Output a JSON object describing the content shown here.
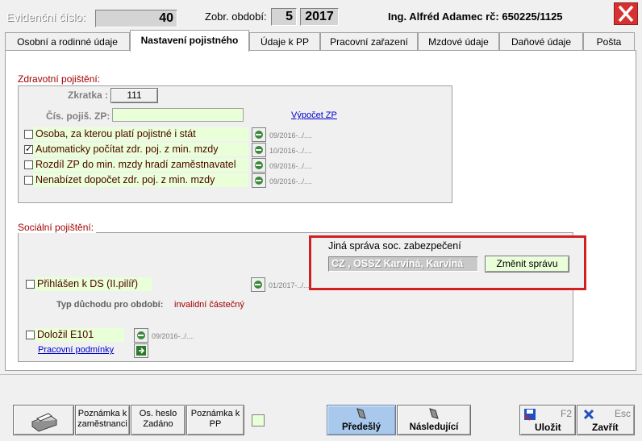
{
  "header": {
    "ev_cislo_label": "Evidenční číslo:",
    "ev_cislo_value": "40",
    "obdobi_label": "Zobr. období:",
    "obdobi_month": "5",
    "obdobi_year": "2017",
    "employee": "Ing. Alfréd Adamec rč: 650225/1125"
  },
  "tabs": [
    {
      "label": "Osobní a rodinné údaje"
    },
    {
      "label": "Nastavení pojistného"
    },
    {
      "label": "Údaje k PP"
    },
    {
      "label": "Pracovní zařazení"
    },
    {
      "label": "Mzdové údaje"
    },
    {
      "label": "Daňové údaje"
    },
    {
      "label": "Pošta"
    }
  ],
  "zdrav": {
    "legend": "Zdravotní pojištění:",
    "zkratka_label": "Zkratka :",
    "zkratka_value": "111",
    "cis_label": "Čís. pojiš. ZP:",
    "cis_value": "",
    "vypocet_link": "Výpočet ZP",
    "items": [
      {
        "label": "Osoba, za kterou platí pojistné i stát",
        "checked": false,
        "date": "09/2016-../...."
      },
      {
        "label": "Automaticky počítat zdr. poj. z min. mzdy",
        "checked": true,
        "date": "10/2016-../...."
      },
      {
        "label": "Rozdíl ZP do min. mzdy hradí zaměstnavatel",
        "checked": false,
        "date": "09/2016-../...."
      },
      {
        "label": "Nenabízet dopočet zdr. poj. z min. mzdy",
        "checked": false,
        "date": "09/2016-../...."
      }
    ]
  },
  "soc": {
    "legend": "Sociální pojištění:",
    "jina_label": "Jiná správa soc. zabezpečení",
    "jina_value": "CZ , OSSZ Karviná, Karviná",
    "zmenit_button": "Změnit správu",
    "ds_label": "Přihlášen k DS (II.pilíř)",
    "ds_date": "01/2017-../....",
    "typ_label": "Typ důchodu pro období:",
    "typ_value": "invalidní částečný",
    "e101_label": "Doložil E101",
    "e101_date": "09/2016-../....",
    "podminky_link": "Pracovní podmínky"
  },
  "bottom": {
    "pozn_zam": "Poznámka k zaměstnanci",
    "os_heslo_1": "Os. heslo",
    "os_heslo_2": "Zadáno",
    "pozn_pp": "Poznámka k PP",
    "predesly": "Předešlý",
    "nasledujici": "Následující",
    "ulozit": "Uložit",
    "ulozit_key": "F2",
    "zavrit": "Zavřít",
    "zavrit_key": "Esc"
  },
  "colors": {
    "highlight_border": "#d02020",
    "legend_red": "#a00000",
    "green_field": "#e8ffd8"
  }
}
